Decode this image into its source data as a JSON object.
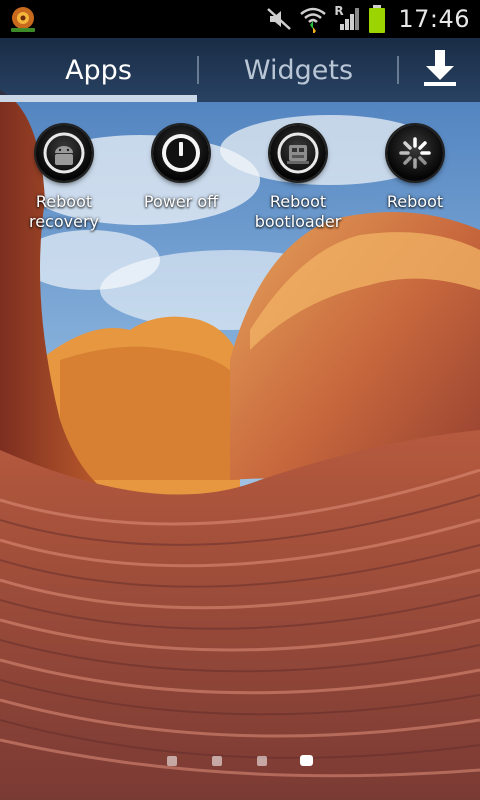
{
  "status_bar": {
    "time": "17:46",
    "roaming_label": "R",
    "icons": [
      "app-logo-icon",
      "mute-icon",
      "wifi-icon",
      "signal-icon",
      "battery-icon"
    ]
  },
  "tabs": [
    {
      "label": "Apps",
      "selected": true
    },
    {
      "label": "Widgets",
      "selected": false
    }
  ],
  "download_button": {
    "icon": "download-icon"
  },
  "apps": [
    {
      "label": "Reboot\nrecovery",
      "icon": "android-recovery-icon"
    },
    {
      "label": "Power off",
      "icon": "power-icon"
    },
    {
      "label": "Reboot\nbootloader",
      "icon": "bootloader-icon"
    },
    {
      "label": "Reboot",
      "icon": "reboot-spinner-icon"
    }
  ],
  "page_indicator": {
    "pages": 4,
    "current": 4
  },
  "colors": {
    "status_bar_bg": "#000000",
    "battery": "#9bd400",
    "tab_indicator": "#c9d7e6"
  }
}
